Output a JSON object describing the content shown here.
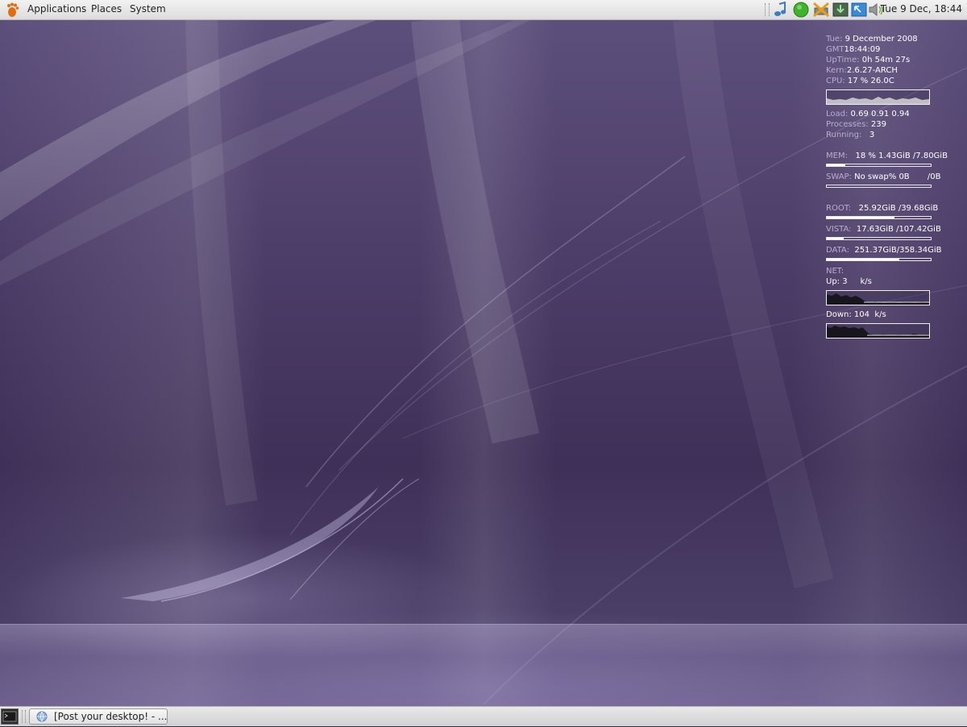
{
  "top_panel": {
    "menus": [
      "Applications",
      "Places",
      "System"
    ],
    "clock": "Tue  9 Dec, 18:44",
    "tray_icons": [
      "music-note-icon",
      "status-green-icon",
      "network-disconnected-icon",
      "download-arrow-icon",
      "update-notifier-icon",
      "volume-icon"
    ]
  },
  "bottom_panel": {
    "task_button_label": "[Post your desktop! - ..."
  },
  "conky": {
    "date": {
      "label": "Tue:",
      "value": "9 December 2008"
    },
    "gmt": {
      "label": "GMT",
      "value": "18:44:09"
    },
    "uptime": {
      "label": "UpTime:",
      "value": "0h 54m 27s"
    },
    "kern": {
      "label": "Kern:",
      "value": "2.6.27-ARCH"
    },
    "cpu": {
      "label": "CPU:",
      "value": "17 % 26.0C"
    },
    "load": {
      "label": "Load:",
      "value": "0.69 0.91 0.94"
    },
    "processes": {
      "label": "Processes:",
      "value": "239"
    },
    "running": {
      "label": "Running:",
      "value": "3"
    },
    "mem": {
      "label": "MEM:",
      "value": "18 % 1.43GiB  /7.80GiB",
      "fraction": 0.18
    },
    "swap": {
      "label": "SWAP:",
      "value": "No swap% 0B       /0B",
      "fraction": 0.0
    },
    "root": {
      "label": "ROOT:",
      "value": "25.92GiB /39.68GiB",
      "fraction": 0.65
    },
    "vista": {
      "label": "VISTA:",
      "value": "17.63GiB /107.42GiB",
      "fraction": 0.16
    },
    "data": {
      "label": "DATA:",
      "value": "251.37GiB/358.34GiB",
      "fraction": 0.7
    },
    "net": {
      "label": "NET:"
    },
    "up": {
      "label": "Up:",
      "value": "3",
      "unit": "k/s"
    },
    "down": {
      "label": "Down:",
      "value": "104",
      "unit": "k/s"
    }
  }
}
